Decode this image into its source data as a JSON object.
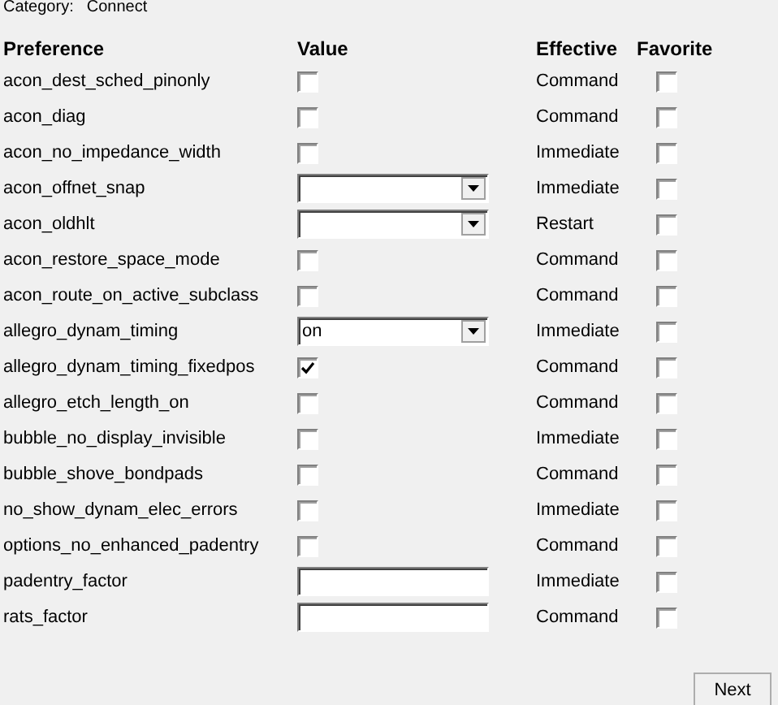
{
  "category": {
    "label": "Category:",
    "value": "Connect"
  },
  "columns": [
    "Preference",
    "Value",
    "Effective",
    "Favorite"
  ],
  "rows": [
    {
      "name": "acon_dest_sched_pinonly",
      "kind": "checkbox",
      "checked": false,
      "effective": "Command",
      "favorite": false
    },
    {
      "name": "acon_diag",
      "kind": "checkbox",
      "checked": false,
      "effective": "Command",
      "favorite": false
    },
    {
      "name": "acon_no_impedance_width",
      "kind": "checkbox",
      "checked": false,
      "effective": "Immediate",
      "favorite": false
    },
    {
      "name": "acon_offnet_snap",
      "kind": "dropdown",
      "effective": "Immediate",
      "favorite": false
    },
    {
      "name": "acon_oldhlt",
      "kind": "dropdown",
      "effective": "Restart",
      "favorite": false
    },
    {
      "name": "acon_restore_space_mode",
      "kind": "checkbox",
      "checked": false,
      "effective": "Command",
      "favorite": false
    },
    {
      "name": "acon_route_on_active_subclass",
      "kind": "checkbox",
      "checked": false,
      "effective": "Command",
      "favorite": false
    },
    {
      "name": "allegro_dynam_timing",
      "kind": "dropdown",
      "value": "on",
      "effective": "Immediate",
      "favorite": false
    },
    {
      "name": "allegro_dynam_timing_fixedpos",
      "kind": "checkbox",
      "checked": true,
      "effective": "Command",
      "favorite": false
    },
    {
      "name": "allegro_etch_length_on",
      "kind": "checkbox",
      "checked": false,
      "effective": "Command",
      "favorite": false
    },
    {
      "name": "bubble_no_display_invisible",
      "kind": "checkbox",
      "checked": false,
      "effective": "Immediate",
      "favorite": false
    },
    {
      "name": "bubble_shove_bondpads",
      "kind": "checkbox",
      "checked": false,
      "effective": "Command",
      "favorite": false
    },
    {
      "name": "no_show_dynam_elec_errors",
      "kind": "checkbox",
      "checked": false,
      "effective": "Immediate",
      "favorite": false
    },
    {
      "name": "options_no_enhanced_padentry",
      "kind": "checkbox",
      "checked": false,
      "effective": "Command",
      "favorite": false
    },
    {
      "name": "padentry_factor",
      "kind": "text",
      "effective": "Immediate",
      "favorite": false
    },
    {
      "name": "rats_factor",
      "kind": "text",
      "effective": "Command",
      "favorite": false
    }
  ],
  "buttons": [
    "Next"
  ]
}
